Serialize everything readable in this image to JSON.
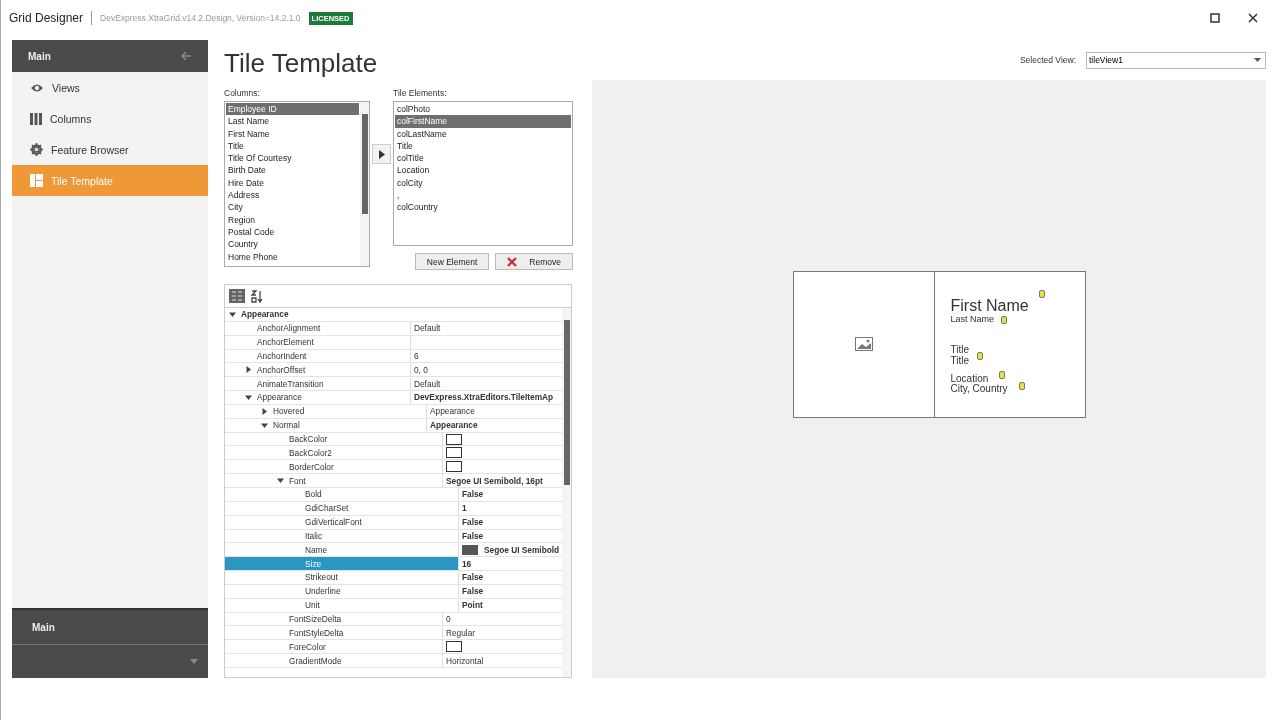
{
  "window": {
    "title": "Grid Designer",
    "subtitle": "DevExpress.XtraGrid.v14.2.Design, Version=14.2.1.0",
    "badge": "LICENSED"
  },
  "sidebar": {
    "header": "Main",
    "items": [
      {
        "label": "Views",
        "selected": false
      },
      {
        "label": "Columns",
        "selected": false
      },
      {
        "label": "Feature Browser",
        "selected": false
      },
      {
        "label": "Tile Template",
        "selected": true
      }
    ],
    "footer": "Main"
  },
  "page_title": "Tile Template",
  "selected_view": {
    "label": "Selected View:",
    "value": "tileView1"
  },
  "columns": {
    "label": "Columns:",
    "items": [
      {
        "text": "Employee ID",
        "selected": true
      },
      {
        "text": "Last Name",
        "selected": false
      },
      {
        "text": "First Name",
        "selected": false
      },
      {
        "text": "Title",
        "selected": false
      },
      {
        "text": "Title Of Courtesy",
        "selected": false
      },
      {
        "text": "Birth Date",
        "selected": false
      },
      {
        "text": "Hire Date",
        "selected": false
      },
      {
        "text": "Address",
        "selected": false
      },
      {
        "text": "City",
        "selected": false
      },
      {
        "text": "Region",
        "selected": false
      },
      {
        "text": "Postal Code",
        "selected": false
      },
      {
        "text": "Country",
        "selected": false
      },
      {
        "text": "Home Phone",
        "selected": false
      }
    ]
  },
  "tile_elements": {
    "label": "Tile Elements:",
    "items": [
      {
        "text": "colPhoto",
        "selected": false
      },
      {
        "text": "colFirstName",
        "selected": true
      },
      {
        "text": "colLastName",
        "selected": false
      },
      {
        "text": "Title",
        "selected": false
      },
      {
        "text": "colTitle",
        "selected": false
      },
      {
        "text": "Location",
        "selected": false
      },
      {
        "text": "colCity",
        "selected": false
      },
      {
        "text": ",",
        "selected": false
      },
      {
        "text": "colCountry",
        "selected": false
      }
    ]
  },
  "buttons": [
    {
      "label": "New Element"
    },
    {
      "label": "Remove"
    }
  ],
  "properties": [
    {
      "name": "Appearance",
      "kind": "category",
      "expanded": true,
      "selected": false,
      "children": [
        {
          "name": "AnchorAlignment",
          "value": "Default",
          "selected": false
        },
        {
          "name": "AnchorElement",
          "selected": false
        },
        {
          "name": "AnchorIndent",
          "value": "6",
          "selected": false
        },
        {
          "name": "AnchorOffset",
          "value": "0, 0",
          "expanded": false,
          "selected": false
        },
        {
          "name": "AnimateTransition",
          "value": "Default",
          "selected": false
        },
        {
          "name": "Appearance",
          "value": "DevExpress.XtraEditors.TileItemAp",
          "bold": true,
          "expanded": true,
          "selected": false,
          "children": [
            {
              "name": "Hovered",
              "value": "Appearance",
              "expanded": false,
              "selected": false
            },
            {
              "name": "Normal",
              "value": "Appearance",
              "bold": true,
              "expanded": true,
              "selected": false,
              "children": [
                {
                  "name": "BackColor",
                  "kind": "color",
                  "selected": false
                },
                {
                  "name": "BackColor2",
                  "kind": "color",
                  "selected": false
                },
                {
                  "name": "BorderColor",
                  "kind": "color",
                  "selected": false
                },
                {
                  "name": "Font",
                  "value": "Segoe UI Semibold, 16pt",
                  "bold": true,
                  "expanded": true,
                  "selected": false,
                  "children": [
                    {
                      "name": "Bold",
                      "value": "False",
                      "bold": true,
                      "selected": false
                    },
                    {
                      "name": "GdiCharSet",
                      "value": "1",
                      "bold": true,
                      "selected": false
                    },
                    {
                      "name": "GdiVerticalFont",
                      "value": "False",
                      "bold": true,
                      "selected": false
                    },
                    {
                      "name": "Italic",
                      "value": "False",
                      "bold": true,
                      "selected": false
                    },
                    {
                      "name": "Name",
                      "value": "Segoe UI Semibold",
                      "kind": "font",
                      "bold": true,
                      "selected": false
                    },
                    {
                      "name": "Size",
                      "value": "16",
                      "bold": true,
                      "selected": true
                    },
                    {
                      "name": "Strikeout",
                      "value": "False",
                      "bold": true,
                      "selected": false
                    },
                    {
                      "name": "Underline",
                      "value": "False",
                      "bold": true,
                      "selected": false
                    },
                    {
                      "name": "Unit",
                      "value": "Point",
                      "bold": true,
                      "selected": false
                    }
                  ]
                },
                {
                  "name": "FontSizeDelta",
                  "value": "0",
                  "selected": false
                },
                {
                  "name": "FontStyleDelta",
                  "value": "Regular",
                  "selected": false
                },
                {
                  "name": "ForeColor",
                  "kind": "color",
                  "selected": false
                },
                {
                  "name": "GradientMode",
                  "value": "Horizontal",
                  "selected": false
                }
              ]
            }
          ]
        }
      ]
    }
  ],
  "tile_preview": {
    "texts": [
      {
        "text": "First Name",
        "kind": "large"
      },
      {
        "text": "Last Name",
        "kind": "small"
      },
      {
        "text": "Title",
        "kind": "normal"
      },
      {
        "text": "Title",
        "kind": "normal"
      },
      {
        "text": "Location",
        "kind": "normal"
      },
      {
        "text": "City, Country",
        "kind": "normal"
      }
    ]
  }
}
